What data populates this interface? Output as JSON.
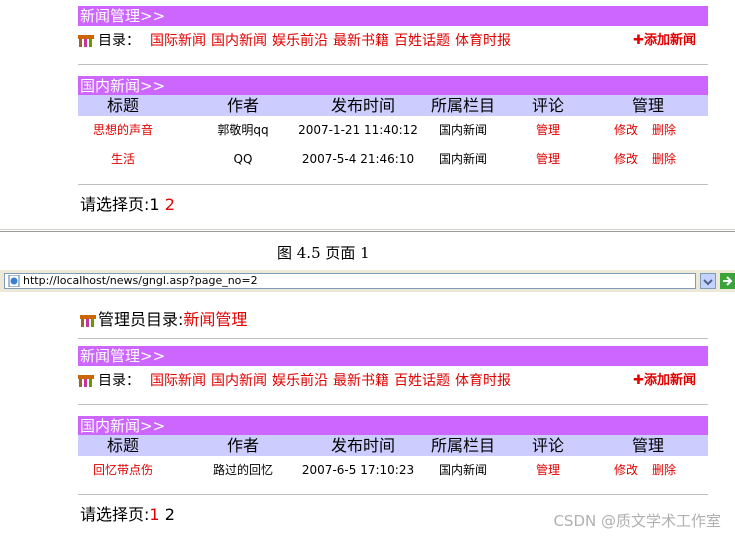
{
  "panel1": {
    "section_bar": "新闻管理>>",
    "nav_label": "目录：",
    "categories": [
      "国际新闻",
      "国内新闻",
      "娱乐前沿",
      "最新书籍",
      "百姓话题",
      "体育时报"
    ],
    "add_link": "✚添加新闻",
    "list_bar": "国内新闻>>",
    "headers": [
      "标题",
      "作者",
      "发布时间",
      "所属栏目",
      "评论",
      "管理"
    ],
    "rows": [
      {
        "title": "思想的声音",
        "author": "郭敬明qq",
        "time": "2007-1-21 11:40:12",
        "column": "国内新闻",
        "comment": "管理",
        "edit": "修改",
        "delete": "删除"
      },
      {
        "title": "生活",
        "author": "QQ",
        "time": "2007-5-4 21:46:10",
        "column": "国内新闻",
        "comment": "管理",
        "edit": "修改",
        "delete": "删除"
      }
    ],
    "pager_label": "请选择页:",
    "pages": [
      "1",
      "2"
    ]
  },
  "caption": "图 4.5 页面 1",
  "address_bar": {
    "url": "http://localhost/news/gngl.asp?page_no=2"
  },
  "panel2": {
    "admin_title_label": "管理员目录:",
    "admin_title_value": "新闻管理",
    "section_bar": "新闻管理>>",
    "nav_label": "目录：",
    "categories": [
      "国际新闻",
      "国内新闻",
      "娱乐前沿",
      "最新书籍",
      "百姓话题",
      "体育时报"
    ],
    "add_link": "✚添加新闻",
    "list_bar": "国内新闻>>",
    "headers": [
      "标题",
      "作者",
      "发布时间",
      "所属栏目",
      "评论",
      "管理"
    ],
    "rows": [
      {
        "title": "回忆带点伤",
        "author": "路过的回忆",
        "time": "2007-6-5 17:10:23",
        "column": "国内新闻",
        "comment": "管理",
        "edit": "修改",
        "delete": "删除"
      }
    ],
    "pager_label": "请选择页:",
    "pages": [
      "1",
      "2"
    ]
  },
  "watermark": "CSDN @质文学术工作室",
  "colors": {
    "bar": "#cc66ff",
    "header": "#ccccff",
    "link": "#e00000"
  }
}
